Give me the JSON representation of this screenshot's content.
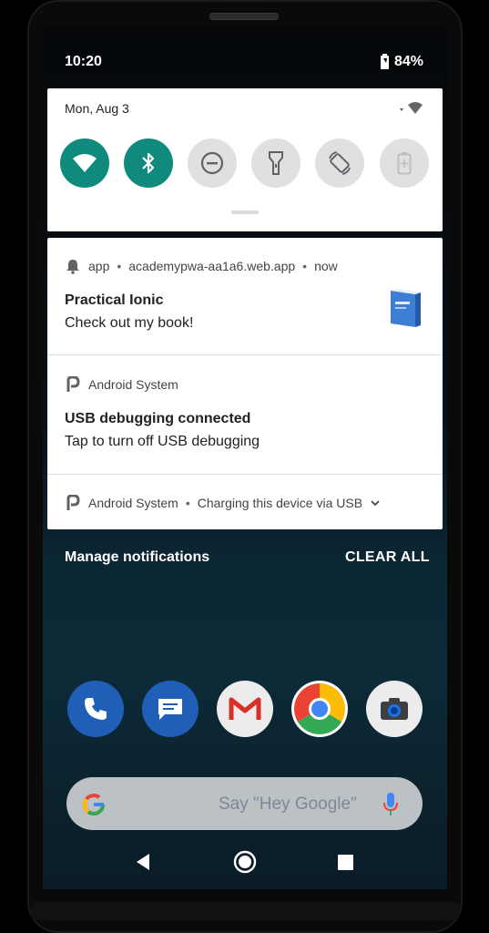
{
  "status_bar": {
    "time": "10:20",
    "battery": "84%"
  },
  "quick_settings": {
    "date": "Mon, Aug 3",
    "tiles": [
      {
        "name": "wifi",
        "state": "on"
      },
      {
        "name": "bluetooth",
        "state": "on"
      },
      {
        "name": "do-not-disturb",
        "state": "off"
      },
      {
        "name": "flashlight",
        "state": "off"
      },
      {
        "name": "auto-rotate",
        "state": "off"
      },
      {
        "name": "battery-saver",
        "state": "off"
      }
    ]
  },
  "notifications": [
    {
      "app": "app",
      "source": "academypwa-aa1a6.web.app",
      "time": "now",
      "title": "Practical Ionic",
      "text": "Check out my book!"
    },
    {
      "app": "Android System",
      "title": "USB debugging connected",
      "text": "Tap to turn off USB debugging"
    },
    {
      "app": "Android System",
      "summary": "Charging this device via USB"
    }
  ],
  "footer": {
    "manage": "Manage notifications",
    "clear_all": "CLEAR ALL"
  },
  "search": {
    "hint": "Say \"Hey Google\""
  },
  "colors": {
    "tile_on": "#0f8a7c",
    "tile_off": "#e0e0e0"
  }
}
